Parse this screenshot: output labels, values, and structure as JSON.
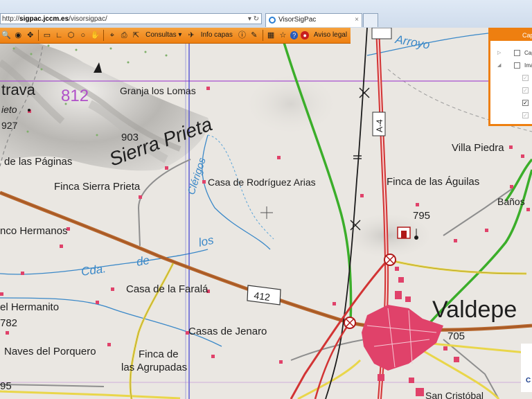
{
  "browser": {
    "url_prefix": "http://",
    "url_domain": "sigpac.jccm.es",
    "url_path": "/visorsigpac/",
    "address_controls": "▾ ↻",
    "tab_title": "VisorSigPac",
    "tab_close": "×"
  },
  "toolbar": {
    "consultas_label": "Consultas",
    "consultas_caret": "▾",
    "info_capas_label": "Info capas",
    "aviso_legal_label": "Aviso legal"
  },
  "layers_panel": {
    "header": "Cap",
    "rows": [
      {
        "label": "Cap",
        "checked": false
      },
      {
        "label": "Imá",
        "checked": false
      }
    ],
    "sub_checks": [
      false,
      false,
      true,
      false
    ]
  },
  "colors": {
    "toolbar_orange": "#ee7f10",
    "highway_red": "#d23434",
    "road_green": "#3bae2a",
    "road_yellow": "#e9d64a",
    "road_brown": "#b5652c",
    "water_blue": "#3a88c8",
    "grid_blue": "#3b3bd0",
    "grid_purple": "#a64fd0",
    "town_pink": "#e0426a"
  },
  "map_labels": {
    "trava": "trava",
    "ieto": "ieto",
    "e927": "927",
    "e812": "812",
    "granja": "Granja los Lomas",
    "e903": "903",
    "sierra": "Sierra Prieta",
    "paginas": "de las Páginas",
    "finca_sierra": "Finca Sierra Prieta",
    "clerigos": "Clérigos",
    "rodriguez": "Casa de Rodríguez Arias",
    "aguilas": "Finca de las Águilas",
    "villa": "Villa Piedra",
    "banos": "Baños",
    "e795": "795",
    "arroyo": "Arroyo",
    "a4": "A-4",
    "hermanos": "nco Hermanos",
    "los": "los",
    "cda": "Cda.",
    "de": "de",
    "faral": "Casa de la Faralá",
    "r412": "412",
    "hermanito": "el Hermanito",
    "e782": "782",
    "jenaro": "Casas de Jenaro",
    "naves": "Naves del Porquero",
    "agrupadas1": "Finca de",
    "agrupadas2": "las Agrupadas",
    "e95": "95",
    "valdepe": "Valdepe",
    "e705": "705",
    "sancristobal": "San Cristóbal",
    "corner_mark": "C"
  }
}
